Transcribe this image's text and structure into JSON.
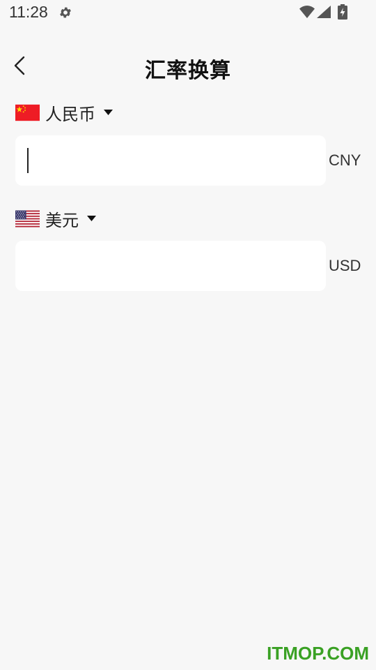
{
  "status_bar": {
    "time": "11:28",
    "icons": [
      "gear-icon",
      "wifi-icon",
      "signal-icon",
      "battery-icon"
    ]
  },
  "header": {
    "title": "汇率换算",
    "back_icon": "chevron-left-icon"
  },
  "from_currency": {
    "name": "人民币",
    "code": "CNY",
    "flag": "china-flag-icon",
    "amount_value": ""
  },
  "to_currency": {
    "name": "美元",
    "code": "USD",
    "flag": "usa-flag-icon",
    "amount_value": ""
  },
  "watermark": "ITMOP.COM",
  "colors": {
    "background": "#f7f7f7",
    "input_background": "#ffffff",
    "watermark": "#3aa124",
    "china_red": "#ee1c25",
    "china_yellow": "#ffde00",
    "usa_blue": "#3c3b6e",
    "usa_red": "#b22234"
  }
}
